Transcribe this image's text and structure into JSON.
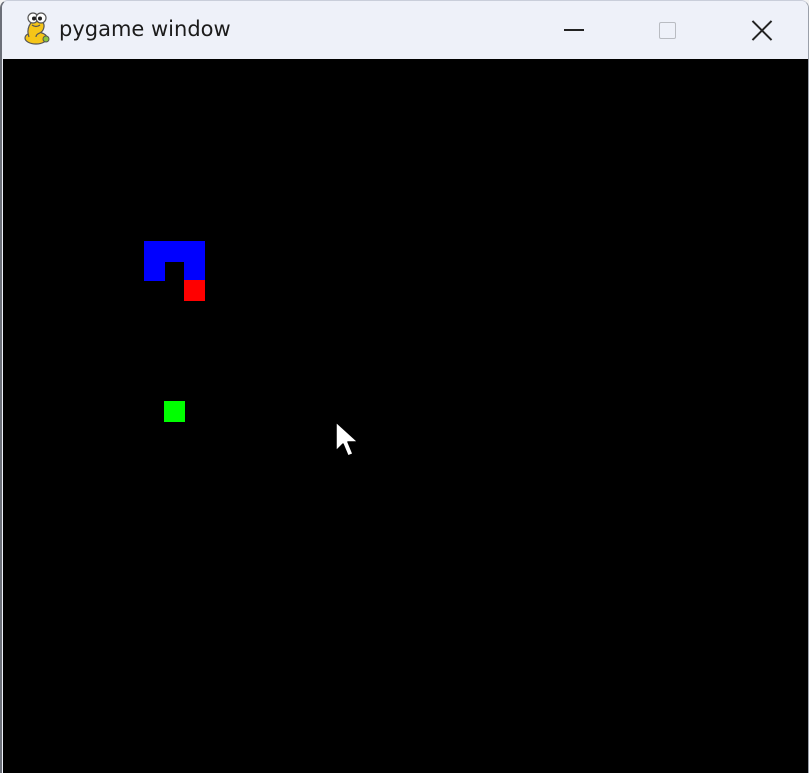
{
  "window": {
    "title": "pygame window",
    "icon": "pygame-snake-logo-icon",
    "controls": {
      "minimize_icon": "minimize-icon",
      "maximize_icon": "maximize-icon",
      "close_icon": "close-icon"
    }
  },
  "game": {
    "background_color": "#000000",
    "snake_body_color": "#0000ff",
    "snake_head_color": "#ff0000",
    "food_color": "#00ff00",
    "cursor_icon": "mouse-pointer-icon"
  }
}
